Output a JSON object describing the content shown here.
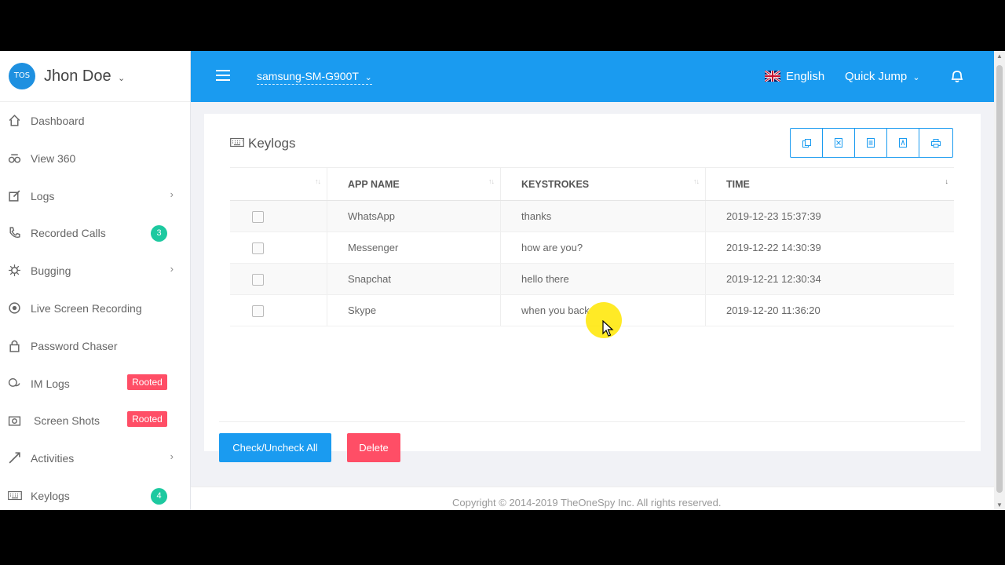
{
  "user": {
    "avatar_text": "TOS",
    "name": "Jhon Doe"
  },
  "sidebar": {
    "items": [
      {
        "label": "Dashboard",
        "icon": "home-icon"
      },
      {
        "label": "View 360",
        "icon": "binoculars-icon"
      },
      {
        "label": "Logs",
        "icon": "edit-icon",
        "has_children": true
      },
      {
        "label": "Recorded Calls",
        "icon": "phone-icon",
        "badge": "3"
      },
      {
        "label": "Bugging",
        "icon": "bug-icon",
        "has_children": true
      },
      {
        "label": "Live Screen Recording",
        "icon": "record-icon"
      },
      {
        "label": "Password Chaser",
        "icon": "lock-icon"
      },
      {
        "label": "IM Logs",
        "icon": "chat-icon",
        "tag": "Rooted"
      },
      {
        "label": "Screen Shots",
        "icon": "camera-icon",
        "tag": "Rooted"
      },
      {
        "label": "Activities",
        "icon": "activity-icon",
        "has_children": true
      },
      {
        "label": "Keylogs",
        "icon": "keyboard-icon",
        "badge": "4"
      }
    ]
  },
  "topbar": {
    "device": "samsung-SM-G900T",
    "language": "English",
    "quick_jump": "Quick Jump",
    "bg_color": "#1a9bf0"
  },
  "card": {
    "title": "Keylogs",
    "columns": [
      "",
      "APP NAME",
      "KEYSTROKES",
      "TIME"
    ],
    "rows": [
      {
        "app": "WhatsApp",
        "keys": "thanks",
        "time": "2019-12-23 15:37:39"
      },
      {
        "app": "Messenger",
        "keys": "how are you?",
        "time": "2019-12-22 14:30:39"
      },
      {
        "app": "Snapchat",
        "keys": "hello there",
        "time": "2019-12-21 12:30:34"
      },
      {
        "app": "Skype",
        "keys": "when you back",
        "time": "2019-12-20 11:36:20"
      }
    ],
    "check_all_label": "Check/Uncheck All",
    "delete_label": "Delete"
  },
  "footer": {
    "text": "Copyright © 2014-2019 TheOneSpy Inc. All rights reserved."
  },
  "colors": {
    "primary": "#1a9bf0",
    "danger": "#ff4e66",
    "success": "#1dc9a0"
  }
}
